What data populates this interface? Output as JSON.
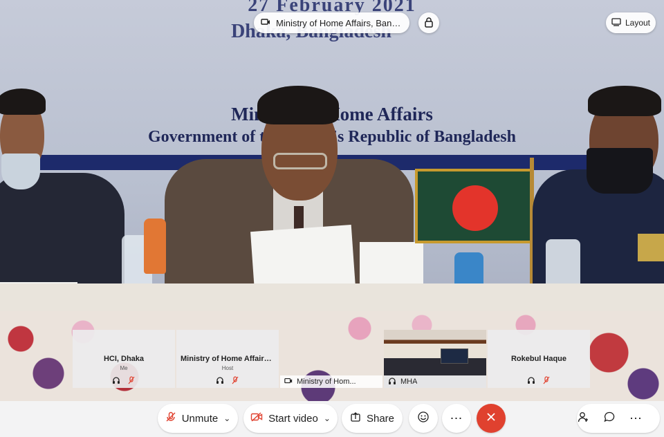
{
  "banner": {
    "date_text": "27 February 2021",
    "city_text": "Dhaka, Bangladesh",
    "ministry_text": "Ministry of Home Affairs",
    "government_text": "Government of the People's Republic of Bangladesh"
  },
  "header": {
    "meeting_title": "Ministry of Home Affairs, Bangla...",
    "layout_label": "Layout"
  },
  "participants": [
    {
      "name": "HCI, Dhaka",
      "role": "Me",
      "type": "avatar"
    },
    {
      "name": "Ministry of Home Affairs ...",
      "role": "Host",
      "type": "avatar"
    },
    {
      "name": "Ministry of Hom...",
      "role": "",
      "type": "shared"
    },
    {
      "name": "MHA",
      "role": "",
      "type": "video"
    },
    {
      "name": "Rokebul Haque",
      "role": "",
      "type": "avatar"
    }
  ],
  "controls": {
    "unmute_label": "Unmute",
    "start_video_label": "Start video",
    "share_label": "Share",
    "more_glyph": "⋯",
    "extra_glyph": "⋯"
  },
  "colors": {
    "leave_button": "#e0412f",
    "muted_indicator": "#e0412f",
    "flag_green": "#1e4a34",
    "flag_red": "#e3342b"
  },
  "icons": [
    "meeting-icon",
    "lock-icon",
    "layout-icon",
    "headset-icon",
    "mic-muted-icon",
    "video-off-icon",
    "share-icon",
    "reaction-icon",
    "more-icon",
    "close-icon",
    "participants-icon",
    "chat-icon"
  ]
}
